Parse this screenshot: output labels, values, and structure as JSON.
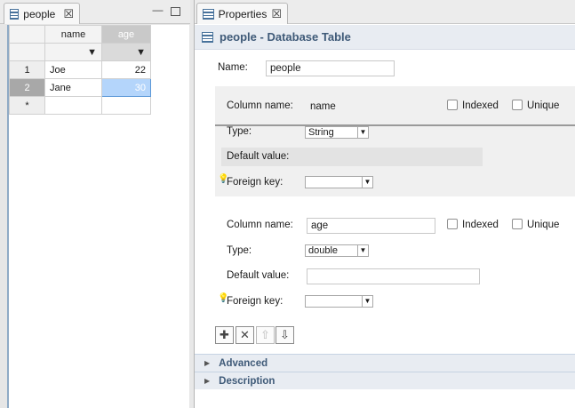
{
  "left_tab": {
    "title": "people"
  },
  "grid": {
    "columns": [
      "name",
      "age"
    ],
    "rows": [
      {
        "num": "1",
        "name": "Joe",
        "age": "22"
      },
      {
        "num": "2",
        "name": "Jane",
        "age": "30"
      }
    ],
    "new_row_marker": "*"
  },
  "right_tab": {
    "title": "Properties"
  },
  "panel": {
    "title": "people - Database Table"
  },
  "table_name": {
    "label": "Name:",
    "value": "people"
  },
  "column1": {
    "name_label": "Column name:",
    "name_value": "name",
    "indexed_label": "Indexed",
    "unique_label": "Unique",
    "type_label": "Type:",
    "type_value": "String",
    "default_label": "Default value:",
    "fk_label": "Foreign key:"
  },
  "column2": {
    "name_label": "Column name:",
    "name_value": "age",
    "indexed_label": "Indexed",
    "unique_label": "Unique",
    "type_label": "Type:",
    "type_value": "double",
    "default_label": "Default value:",
    "fk_label": "Foreign key:"
  },
  "toolbar": {
    "add": "✚",
    "remove": "✕",
    "up": "⇧",
    "down": "⇩"
  },
  "sections": {
    "advanced": "Advanced",
    "description": "Description"
  }
}
